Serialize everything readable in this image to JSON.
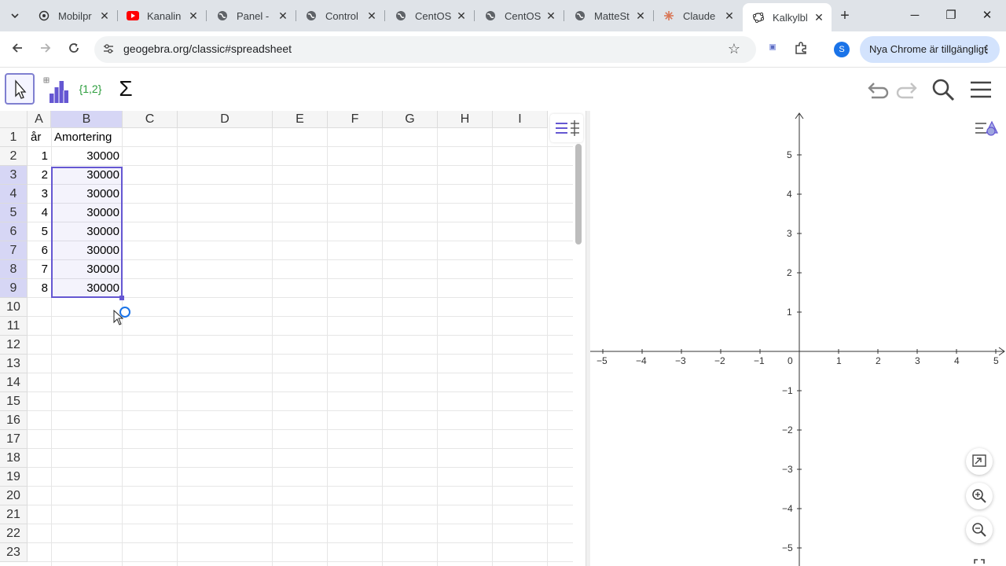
{
  "browser": {
    "tabs": [
      {
        "title": "Mobilpr",
        "favicon": "openai-icon"
      },
      {
        "title": "Kanalin",
        "favicon": "youtube-icon"
      },
      {
        "title": "Panel - ",
        "favicon": "globe-icon"
      },
      {
        "title": "Control",
        "favicon": "globe-icon"
      },
      {
        "title": "CentOS",
        "favicon": "globe-icon"
      },
      {
        "title": "CentOS",
        "favicon": "globe-icon"
      },
      {
        "title": "MatteSt",
        "favicon": "globe-icon"
      },
      {
        "title": "Claude",
        "favicon": "claude-icon"
      },
      {
        "title": "Kalkylbl",
        "favicon": "geogebra-icon",
        "active": true
      }
    ],
    "url": "geogebra.org/classic#spreadsheet",
    "profile_initial": "S",
    "update_label": "Nya Chrome är tillgängligt"
  },
  "geogebra": {
    "tools": {
      "list_label": "{1,2}",
      "sum_label": "Σ"
    },
    "spreadsheet": {
      "columns": [
        "A",
        "B",
        "C",
        "D",
        "E",
        "F",
        "G",
        "H",
        "I"
      ],
      "rows": [
        "1",
        "2",
        "3",
        "4",
        "5",
        "6",
        "7",
        "8",
        "9",
        "10",
        "11",
        "12",
        "13",
        "14",
        "15",
        "16",
        "17",
        "18",
        "19",
        "20",
        "21",
        "22",
        "23"
      ],
      "selected_column": "B",
      "selected_rows": [
        "3",
        "4",
        "5",
        "6",
        "7",
        "8",
        "9"
      ],
      "cells": {
        "A1": "år",
        "B1": "Amortering",
        "A2": "1",
        "B2": "30000",
        "A3": "2",
        "B3": "30000",
        "A4": "3",
        "B4": "30000",
        "A5": "4",
        "B5": "30000",
        "A6": "5",
        "B6": "30000",
        "A7": "6",
        "B7": "30000",
        "A8": "7",
        "B8": "30000",
        "A9": "8",
        "B9": "30000"
      },
      "selection_color": "#6557d2"
    },
    "graphics": {
      "x_ticks": [
        "−5",
        "−4",
        "−3",
        "−2",
        "−1",
        "0",
        "1",
        "2",
        "3",
        "4",
        "5"
      ],
      "y_ticks": [
        "5",
        "4",
        "3",
        "2",
        "1",
        "−1",
        "−2",
        "−3",
        "−4",
        "−5"
      ]
    }
  }
}
